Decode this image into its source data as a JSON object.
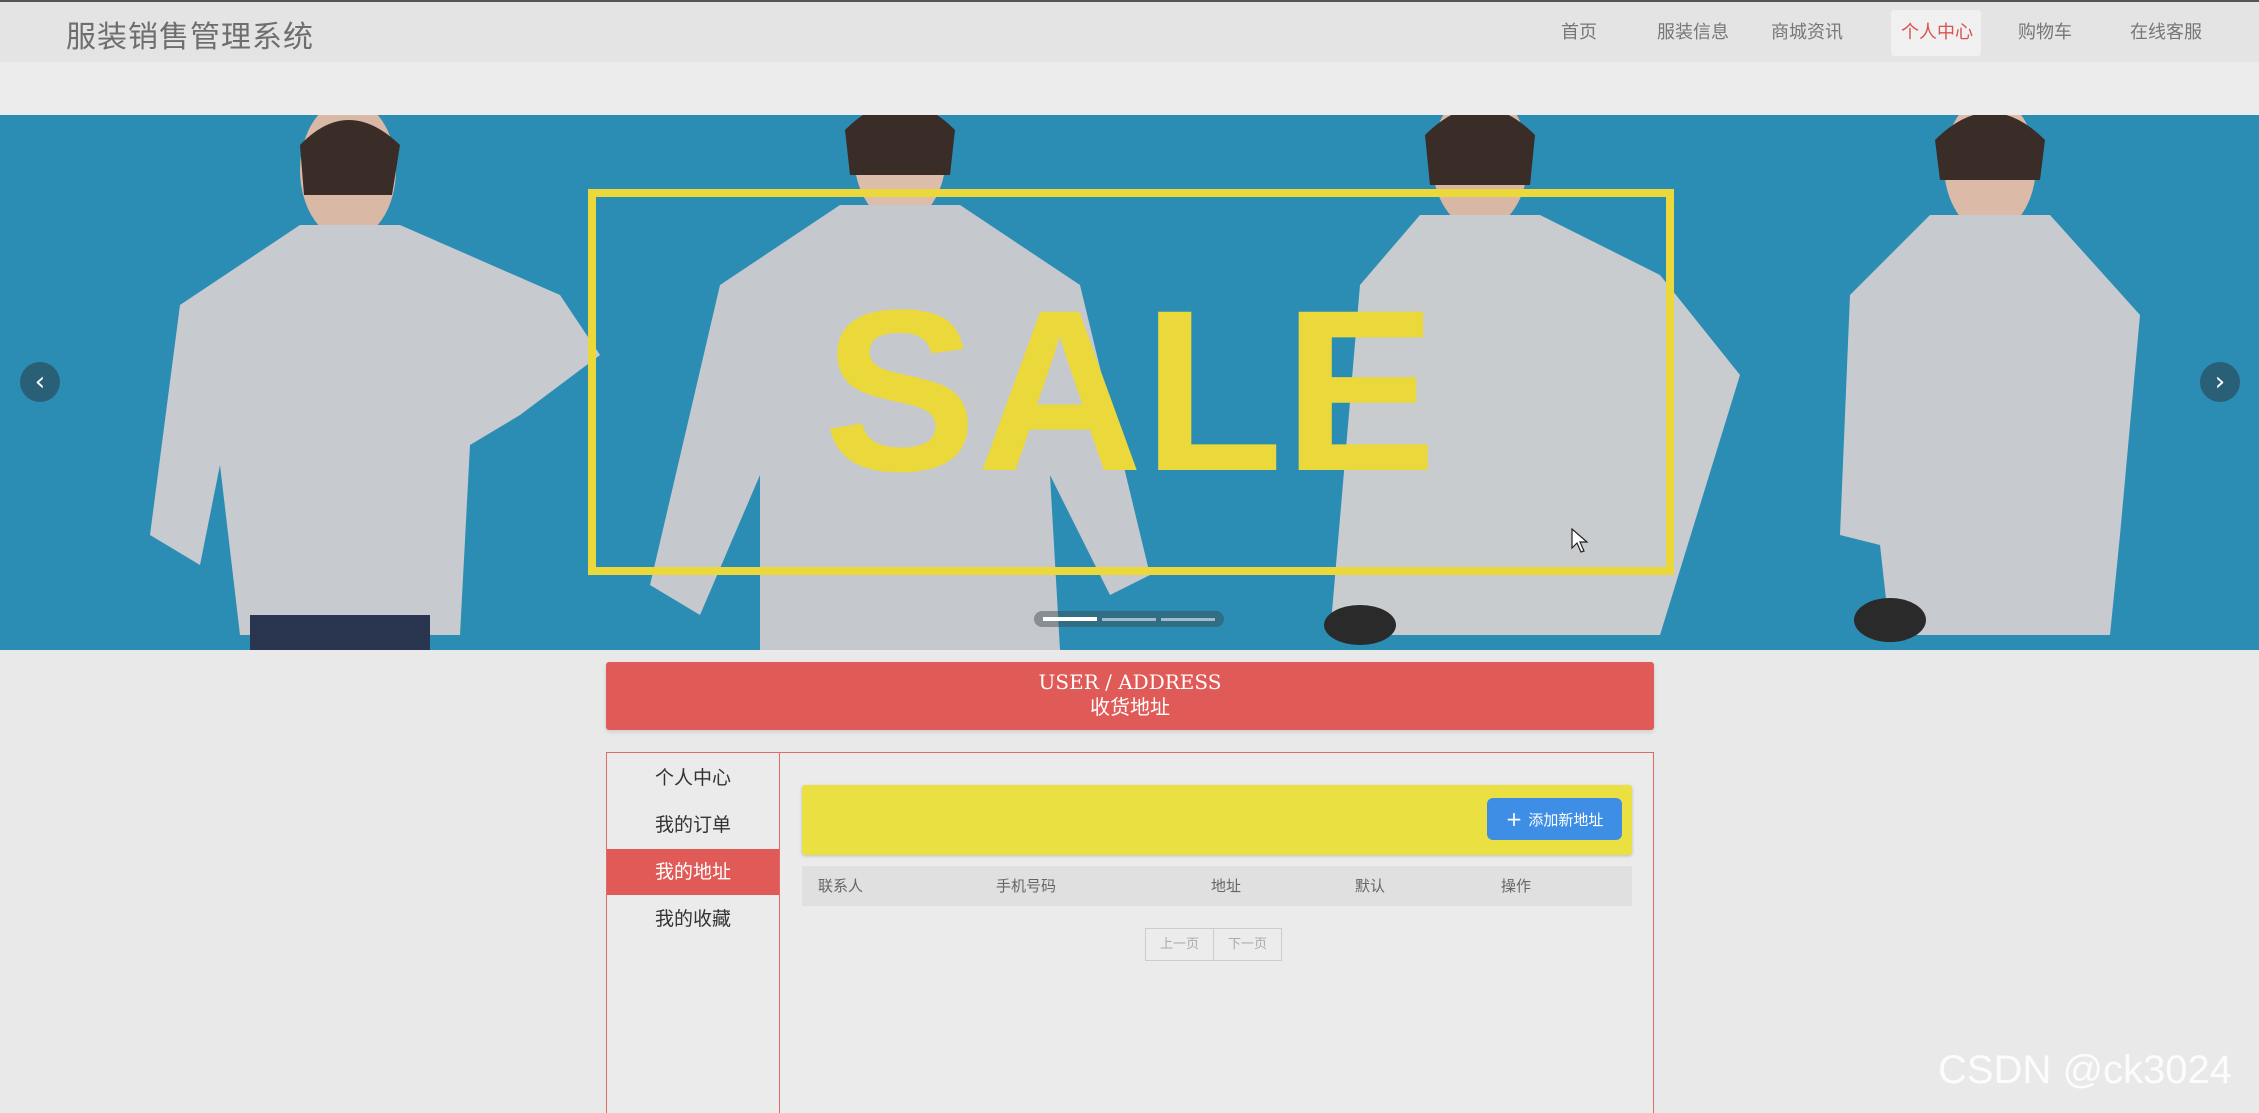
{
  "header": {
    "brand": "服装销售管理系统",
    "nav": [
      {
        "label": "首页",
        "active": false
      },
      {
        "label": "服装信息",
        "active": false
      },
      {
        "label": "商城资讯",
        "active": false
      },
      {
        "label": "个人中心",
        "active": true
      },
      {
        "label": "购物车",
        "active": false
      },
      {
        "label": "在线客服",
        "active": false
      }
    ]
  },
  "banner": {
    "text": "SALE",
    "prev_icon": "chevron-left-icon",
    "next_icon": "chevron-right-icon",
    "slide_count": 3,
    "active_slide": 1,
    "colors": {
      "background": "#2c8fb5",
      "accent": "#ebd83a",
      "garment": "#c9ccd0"
    }
  },
  "section": {
    "title_en": "USER / ADDRESS",
    "title_cn": "收货地址"
  },
  "sidebar": {
    "items": [
      {
        "label": "个人中心",
        "active": false
      },
      {
        "label": "我的订单",
        "active": false
      },
      {
        "label": "我的地址",
        "active": true
      },
      {
        "label": "我的收藏",
        "active": false
      }
    ]
  },
  "toolbar": {
    "add_label": "添加新地址",
    "add_icon": "plus-icon"
  },
  "table": {
    "columns": [
      "联系人",
      "手机号码",
      "地址",
      "默认",
      "操作"
    ],
    "rows": []
  },
  "pager": {
    "prev": "上一页",
    "next": "下一页"
  },
  "watermark": "CSDN @ck3024",
  "colors": {
    "accent_red": "#e05b57",
    "toolbar_yellow": "#ebe042",
    "button_blue": "#3e8ee6"
  }
}
